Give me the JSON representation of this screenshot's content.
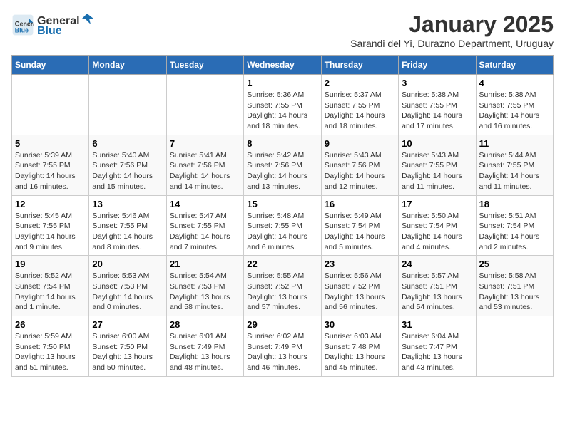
{
  "header": {
    "logo_general": "General",
    "logo_blue": "Blue",
    "month": "January 2025",
    "subtitle": "Sarandi del Yi, Durazno Department, Uruguay"
  },
  "weekdays": [
    "Sunday",
    "Monday",
    "Tuesday",
    "Wednesday",
    "Thursday",
    "Friday",
    "Saturday"
  ],
  "weeks": [
    [
      {
        "day": "",
        "info": ""
      },
      {
        "day": "",
        "info": ""
      },
      {
        "day": "",
        "info": ""
      },
      {
        "day": "1",
        "info": "Sunrise: 5:36 AM\nSunset: 7:55 PM\nDaylight: 14 hours\nand 18 minutes."
      },
      {
        "day": "2",
        "info": "Sunrise: 5:37 AM\nSunset: 7:55 PM\nDaylight: 14 hours\nand 18 minutes."
      },
      {
        "day": "3",
        "info": "Sunrise: 5:38 AM\nSunset: 7:55 PM\nDaylight: 14 hours\nand 17 minutes."
      },
      {
        "day": "4",
        "info": "Sunrise: 5:38 AM\nSunset: 7:55 PM\nDaylight: 14 hours\nand 16 minutes."
      }
    ],
    [
      {
        "day": "5",
        "info": "Sunrise: 5:39 AM\nSunset: 7:55 PM\nDaylight: 14 hours\nand 16 minutes."
      },
      {
        "day": "6",
        "info": "Sunrise: 5:40 AM\nSunset: 7:56 PM\nDaylight: 14 hours\nand 15 minutes."
      },
      {
        "day": "7",
        "info": "Sunrise: 5:41 AM\nSunset: 7:56 PM\nDaylight: 14 hours\nand 14 minutes."
      },
      {
        "day": "8",
        "info": "Sunrise: 5:42 AM\nSunset: 7:56 PM\nDaylight: 14 hours\nand 13 minutes."
      },
      {
        "day": "9",
        "info": "Sunrise: 5:43 AM\nSunset: 7:56 PM\nDaylight: 14 hours\nand 12 minutes."
      },
      {
        "day": "10",
        "info": "Sunrise: 5:43 AM\nSunset: 7:55 PM\nDaylight: 14 hours\nand 11 minutes."
      },
      {
        "day": "11",
        "info": "Sunrise: 5:44 AM\nSunset: 7:55 PM\nDaylight: 14 hours\nand 11 minutes."
      }
    ],
    [
      {
        "day": "12",
        "info": "Sunrise: 5:45 AM\nSunset: 7:55 PM\nDaylight: 14 hours\nand 9 minutes."
      },
      {
        "day": "13",
        "info": "Sunrise: 5:46 AM\nSunset: 7:55 PM\nDaylight: 14 hours\nand 8 minutes."
      },
      {
        "day": "14",
        "info": "Sunrise: 5:47 AM\nSunset: 7:55 PM\nDaylight: 14 hours\nand 7 minutes."
      },
      {
        "day": "15",
        "info": "Sunrise: 5:48 AM\nSunset: 7:55 PM\nDaylight: 14 hours\nand 6 minutes."
      },
      {
        "day": "16",
        "info": "Sunrise: 5:49 AM\nSunset: 7:54 PM\nDaylight: 14 hours\nand 5 minutes."
      },
      {
        "day": "17",
        "info": "Sunrise: 5:50 AM\nSunset: 7:54 PM\nDaylight: 14 hours\nand 4 minutes."
      },
      {
        "day": "18",
        "info": "Sunrise: 5:51 AM\nSunset: 7:54 PM\nDaylight: 14 hours\nand 2 minutes."
      }
    ],
    [
      {
        "day": "19",
        "info": "Sunrise: 5:52 AM\nSunset: 7:54 PM\nDaylight: 14 hours\nand 1 minute."
      },
      {
        "day": "20",
        "info": "Sunrise: 5:53 AM\nSunset: 7:53 PM\nDaylight: 14 hours\nand 0 minutes."
      },
      {
        "day": "21",
        "info": "Sunrise: 5:54 AM\nSunset: 7:53 PM\nDaylight: 13 hours\nand 58 minutes."
      },
      {
        "day": "22",
        "info": "Sunrise: 5:55 AM\nSunset: 7:52 PM\nDaylight: 13 hours\nand 57 minutes."
      },
      {
        "day": "23",
        "info": "Sunrise: 5:56 AM\nSunset: 7:52 PM\nDaylight: 13 hours\nand 56 minutes."
      },
      {
        "day": "24",
        "info": "Sunrise: 5:57 AM\nSunset: 7:51 PM\nDaylight: 13 hours\nand 54 minutes."
      },
      {
        "day": "25",
        "info": "Sunrise: 5:58 AM\nSunset: 7:51 PM\nDaylight: 13 hours\nand 53 minutes."
      }
    ],
    [
      {
        "day": "26",
        "info": "Sunrise: 5:59 AM\nSunset: 7:50 PM\nDaylight: 13 hours\nand 51 minutes."
      },
      {
        "day": "27",
        "info": "Sunrise: 6:00 AM\nSunset: 7:50 PM\nDaylight: 13 hours\nand 50 minutes."
      },
      {
        "day": "28",
        "info": "Sunrise: 6:01 AM\nSunset: 7:49 PM\nDaylight: 13 hours\nand 48 minutes."
      },
      {
        "day": "29",
        "info": "Sunrise: 6:02 AM\nSunset: 7:49 PM\nDaylight: 13 hours\nand 46 minutes."
      },
      {
        "day": "30",
        "info": "Sunrise: 6:03 AM\nSunset: 7:48 PM\nDaylight: 13 hours\nand 45 minutes."
      },
      {
        "day": "31",
        "info": "Sunrise: 6:04 AM\nSunset: 7:47 PM\nDaylight: 13 hours\nand 43 minutes."
      },
      {
        "day": "",
        "info": ""
      }
    ]
  ]
}
